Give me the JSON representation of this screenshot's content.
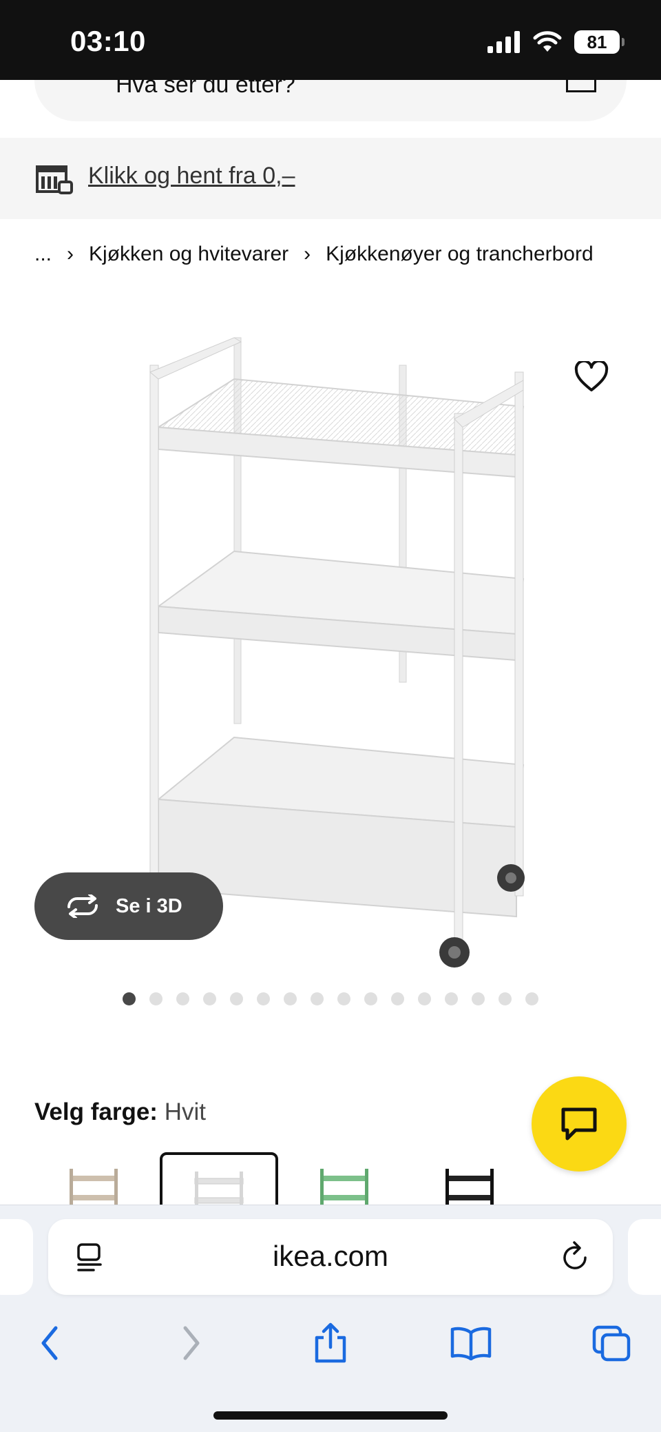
{
  "status_bar": {
    "time": "03:10",
    "battery": "81"
  },
  "search": {
    "placeholder": "Hva ser du etter?"
  },
  "promo": {
    "link_text": "Klikk og hent fra 0,–"
  },
  "breadcrumb": {
    "ellipsis": "...",
    "items": [
      "Kjøkken og hvitevarer",
      "Kjøkkenøyer og trancherbord"
    ]
  },
  "product": {
    "view_3d_label": "Se i 3D",
    "image_count": 16,
    "active_image_index": 0
  },
  "color_picker": {
    "label": "Velg farge:",
    "selected_value": "Hvit",
    "options": [
      {
        "name": "beige",
        "color": "#cdbfad"
      },
      {
        "name": "hvit",
        "color": "#d6d6d6",
        "selected": true
      },
      {
        "name": "grønn",
        "color": "#7cc08a"
      },
      {
        "name": "svart",
        "color": "#222222"
      }
    ]
  },
  "browser": {
    "url": "ikea.com"
  },
  "colors": {
    "chat_button": "#fbd914",
    "accent_blue": "#1a6ae0",
    "dark_pill": "#484848"
  }
}
